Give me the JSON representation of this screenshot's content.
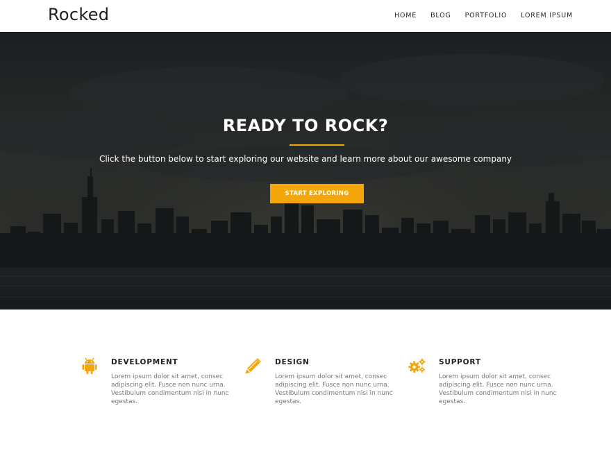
{
  "header": {
    "logo": "Rocked",
    "nav": [
      "HOME",
      "BLOG",
      "PORTFOLIO",
      "LOREM IPSUM"
    ]
  },
  "hero": {
    "title": "READY TO ROCK?",
    "subtitle": "Click the button below to start exploring our website and learn more about our awesome company",
    "button": "START EXPLORING"
  },
  "features": [
    {
      "icon": "android-icon",
      "title": "DEVELOPMENT",
      "text": "Lorem ipsum dolor sit amet, consec adipiscing elit. Fusce non nunc urna. Vestibulum condimentum nisi in nunc egestas."
    },
    {
      "icon": "pencil-icon",
      "title": "DESIGN",
      "text": "Lorem ipsum dolor sit amet, consec adipiscing elit. Fusce non nunc urna. Vestibulum condimentum nisi in nunc egestas."
    },
    {
      "icon": "gears-icon",
      "title": "SUPPORT",
      "text": "Lorem ipsum dolor sit amet, consec adipiscing elit. Fusce non nunc urna. Vestibulum condimentum nisi in nunc egestas."
    }
  ],
  "colors": {
    "accent": "#f5a60b",
    "hero_overlay": "#1a1d1f",
    "text_dark": "#222222",
    "text_muted": "#777777"
  }
}
